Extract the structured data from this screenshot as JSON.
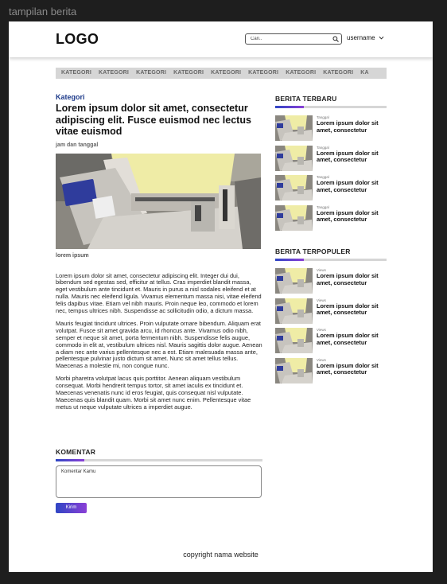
{
  "frame_label": "tampilan berita",
  "header": {
    "logo": "LOGO",
    "search_placeholder": "Cari..",
    "username": "username"
  },
  "nav": {
    "items": [
      "KATEGORI",
      "KATEGORI",
      "KATEGORI",
      "KATEGORI",
      "KATEGORI",
      "KATEGORI",
      "KATEGORI",
      "KATEGORI",
      "KA"
    ]
  },
  "article": {
    "category": "Kategori",
    "title": "Lorem ipsum dolor sit amet, consectetur adipiscing elit. Fusce euismod nec lectus vitae euismod",
    "date": "jam dan tanggal",
    "image_caption": "lorem ipsum",
    "paragraphs": [
      "Lorem ipsum dolor sit amet, consectetur adipiscing elit. Integer dui dui, bibendum sed egestas sed, efficitur at tellus. Cras imperdiet blandit massa, eget vestibulum ante tincidunt et. Mauris in purus a nisl sodales eleifend et at nulla. Mauris nec eleifend ligula. Vivamus elementum massa nisi, vitae eleifend felis dapibus vitae. Etiam vel nibh mauris. Proin neque leo, commodo et lorem nec, tempus ultrices nibh. Suspendisse ac sollicitudin odio, a dictum massa.",
      "Mauris feugiat tincidunt ultrices. Proin vulputate ornare bibendum. Aliquam erat volutpat. Fusce sit amet gravida arcu, id rhoncus ante. Vivamus odio nibh, semper et neque sit amet, porta fermentum nibh. Suspendisse felis augue, commodo in elit at, vestibulum ultrices nisl. Mauris sagittis dolor augue. Aenean a diam nec ante varius pellentesque nec a est. Etiam malesuada massa ante, pellentesque pulvinar justo dictum sit amet. Nunc sit amet tellus tellus. Maecenas a molestie mi, non congue nunc.",
      "Morbi pharetra volutpat lacus quis porttitor. Aenean aliquam vestibulum consequat. Morbi hendrerit tempus tortor, sit amet iaculis ex tincidunt et. Maecenas venenatis nunc id eros feugiat, quis consequat nisl vulputate. Maecenas quis blandit quam. Morbi sit amet nunc enim. Pellentesque vitae metus ut neque vulputate ultrices a imperdiet augue."
    ]
  },
  "comments": {
    "title": "KOMENTAR",
    "placeholder": "Komentar Kamu",
    "submit_label": "Kirim"
  },
  "latest": {
    "title": "BERITA TERBARU",
    "items": [
      {
        "meta": "Tanggal",
        "title": "Lorem ipsum dolor sit amet, consectetur"
      },
      {
        "meta": "Tanggal",
        "title": "Lorem ipsum dolor sit amet, consectetur"
      },
      {
        "meta": "Tanggal",
        "title": "Lorem ipsum dolor sit amet, consectetur"
      },
      {
        "meta": "Tanggal",
        "title": "Lorem ipsum dolor sit amet, consectetur"
      }
    ]
  },
  "popular": {
    "title": "BERITA TERPOPULER",
    "items": [
      {
        "meta": "Views",
        "title": "Lorem ipsum dolor sit amet, consectetur"
      },
      {
        "meta": "Views",
        "title": "Lorem ipsum dolor sit amet, consectetur"
      },
      {
        "meta": "Views",
        "title": "Lorem ipsum dolor sit amet, consectetur"
      },
      {
        "meta": "Views",
        "title": "Lorem ipsum dolor sit amet, consectetur"
      }
    ]
  },
  "footer": {
    "text": "copyright nama website"
  },
  "colors": {
    "accent_start": "#2f46c4",
    "accent_end": "#8a3fd6",
    "category": "#1d3a8a",
    "nav_bg": "#d6d6d6"
  },
  "icons": {
    "search": "search-icon",
    "dropdown": "chevron-down-icon"
  }
}
